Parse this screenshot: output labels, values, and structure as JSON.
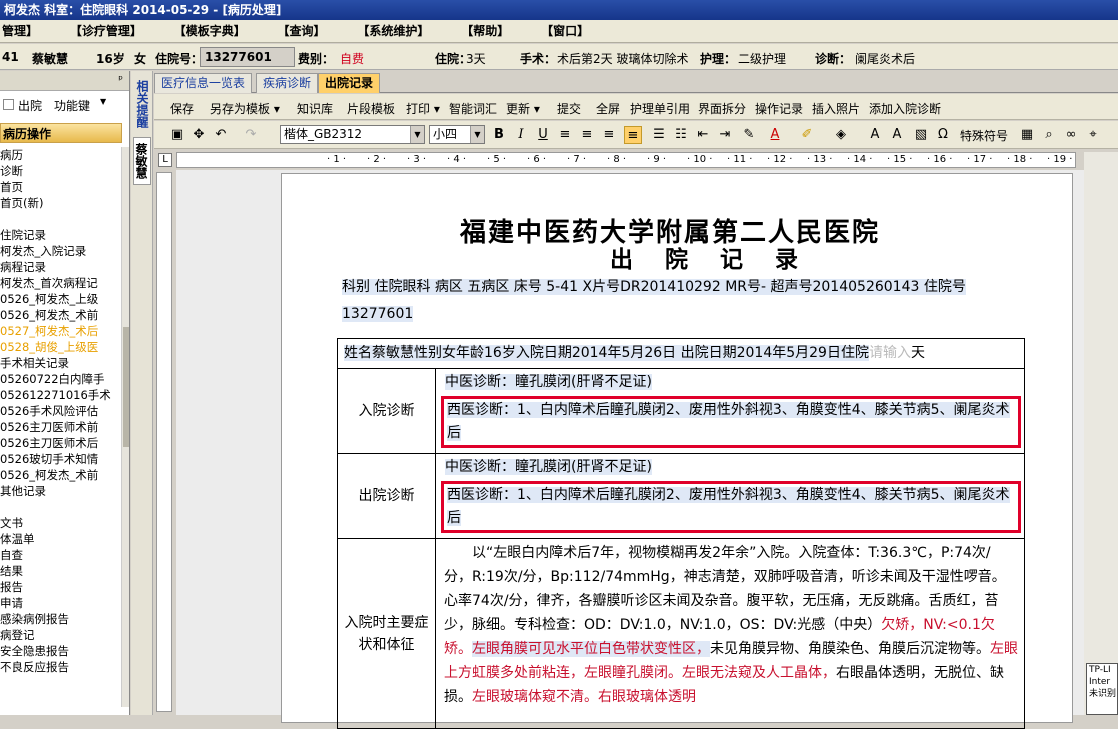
{
  "title": "柯发杰   科室：住院眼科   2014-05-29 - [病历处理]",
  "menu": [
    "管理】",
    "【诊疗管理】",
    "【模板字典】",
    "【查询】",
    "【系统维护】",
    "【帮助】",
    "【窗口】"
  ],
  "patient": {
    "bed": "41",
    "name": "蔡敏慧",
    "age": "16岁",
    "sex": "女",
    "inpatient_label": "住院号：",
    "inpatient_no": "13277601",
    "fee_label": "费别：",
    "fee": "自费",
    "stay_label": "住院：",
    "stay": "3天",
    "surgery_label": "手术：",
    "surgery": "术后第2天 玻璃体切除术",
    "care_label": "护理：",
    "care": "二级护理",
    "diag_label": "诊断：",
    "diag": "阑尾炎术后"
  },
  "left": {
    "chk_label": "出院",
    "func_label": "功能键",
    "section": "病历操作",
    "tree": [
      {
        "t": "病历",
        "c": "#000"
      },
      {
        "t": "诊断",
        "c": "#000"
      },
      {
        "t": "首页",
        "c": "#000"
      },
      {
        "t": "首页(新)",
        "c": "#000"
      },
      {
        "t": "",
        "c": "#000"
      },
      {
        "t": "住院记录",
        "c": "#000"
      },
      {
        "t": "  柯发杰_入院记录",
        "c": "#000"
      },
      {
        "t": "病程记录",
        "c": "#000"
      },
      {
        "t": "  柯发杰_首次病程记",
        "c": "#000"
      },
      {
        "t": "  0526_柯发杰_上级",
        "c": "#000"
      },
      {
        "t": "  0526_柯发杰_术前",
        "c": "#000"
      },
      {
        "t": "  0527_柯发杰_术后",
        "c": "#e8a000"
      },
      {
        "t": "  0528_胡俊_上级医",
        "c": "#e8a000"
      },
      {
        "t": "手术相关记录",
        "c": "#000"
      },
      {
        "t": "  05260722白内障手",
        "c": "#000"
      },
      {
        "t": "  052612271016手术",
        "c": "#000"
      },
      {
        "t": "  0526手术风险评估",
        "c": "#000"
      },
      {
        "t": "  0526主刀医师术前",
        "c": "#000"
      },
      {
        "t": "  0526主刀医师术后",
        "c": "#000"
      },
      {
        "t": "  0526玻切手术知情",
        "c": "#000"
      },
      {
        "t": "  0526_柯发杰_术前",
        "c": "#000"
      },
      {
        "t": "其他记录",
        "c": "#000"
      },
      {
        "t": "",
        "c": "#000"
      },
      {
        "t": "文书",
        "c": "#000"
      },
      {
        "t": "体温单",
        "c": "#000"
      },
      {
        "t": "自查",
        "c": "#000"
      },
      {
        "t": "结果",
        "c": "#000"
      },
      {
        "t": "报告",
        "c": "#000"
      },
      {
        "t": "申请",
        "c": "#000"
      },
      {
        "t": "感染病例报告",
        "c": "#000"
      },
      {
        "t": "病登记",
        "c": "#000"
      },
      {
        "t": "安全隐患报告",
        "c": "#000"
      },
      {
        "t": "不良反应报告",
        "c": "#000"
      }
    ]
  },
  "vtabs": [
    "相关提醒",
    "蔡敏慧"
  ],
  "tabs": [
    "医疗信息一览表",
    "疾病诊断",
    "出院记录"
  ],
  "toolbar1": [
    "保存",
    "另存为模板 ▾",
    "知识库",
    "片段模板",
    "打印 ▾",
    "智能词汇",
    "更新 ▾",
    "提交",
    "全屏",
    "护理单引用",
    "界面拆分",
    "操作记录",
    "插入照片",
    "添加入院诊断"
  ],
  "toolbar2": {
    "font": "楷体_GB2312",
    "size": "小四",
    "special": "特殊符号"
  },
  "doc": {
    "hospital": "福建中医药大学附属第二人民医院",
    "doc_title": "出 院 记 录",
    "info_line": "科别 住院眼科  病区 五病区 床号 5-41  X片号DR201410292 MR号- 超声号201405260143 住院号 13277601",
    "patient_line": "姓名蔡敏慧性别女年龄16岁入院日期2014年5月26日 出院日期2014年5月29日住院",
    "days_placeholder": "请输入",
    "days_unit": "天",
    "admit_label": "入院诊断",
    "admit_tcm": "中医诊断：瞳孔膜闭(肝肾不足证)",
    "admit_west": "西医诊断：1、白内障术后瞳孔膜闭2、废用性外斜视3、角膜变性4、膝关节病5、阑尾炎术后",
    "dis_label": "出院诊断",
    "dis_tcm": "中医诊断：瞳孔膜闭(肝肾不足证)",
    "dis_west": "西医诊断：1、白内障术后瞳孔膜闭2、废用性外斜视3、角膜变性4、膝关节病5、阑尾炎术后",
    "sym_label": "入院时主要症状和体征",
    "sym_text_1": "以“左眼白内障术后7年，视物模糊再发2年余”入院。入院查体：T:36.3℃，P:74次/分，R:19次/分，Bp:112/74mmHg，神志清楚，双肺呼吸音清，听诊未闻及干湿性啰音。心率74次/分，律齐，各瓣膜听诊区未闻及杂音。腹平软，无压痛，无反跳痛。舌质红，苔少，脉细。专科检查：OD：DV:1.0，NV:1.0，OS：DV:光感（中央）",
    "sym_text_2": "欠矫，NV:<0.1欠矫。",
    "sym_text_3": "左眼角膜可见水平位白色带状变性区，",
    "sym_text_4": "未见角膜异物、角膜染色、角膜后沉淀物等。",
    "sym_text_5": "左眼上方虹膜多处前粘连，左眼瞳孔膜闭。左眼无法窥及人工晶体，",
    "sym_text_6": "右眼晶体透明，无脱位、缺损。",
    "sym_text_7": "左眼玻璃体窥不清。右眼玻璃体透明"
  },
  "tip_lines": [
    "TP-LI",
    "Inter",
    "未识别"
  ]
}
